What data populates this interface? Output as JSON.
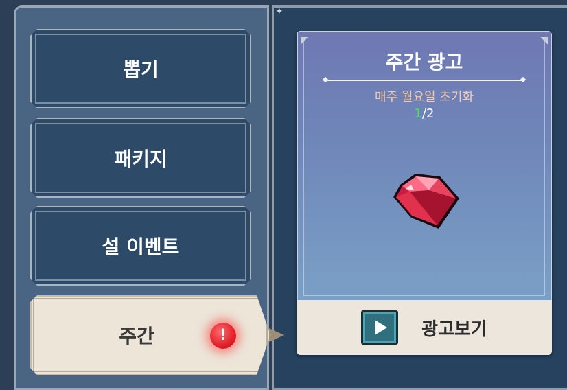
{
  "menu": {
    "items": [
      {
        "label": "뽑기"
      },
      {
        "label": "패키지"
      },
      {
        "label": "설 이벤트"
      },
      {
        "label": "주간",
        "active": true,
        "alert": "!"
      }
    ]
  },
  "ad_card": {
    "title": "주간 광고",
    "reset_text": "매주 월요일 초기화",
    "count_done": "1",
    "count_total": "/2",
    "reward_icon": "red-gem-icon",
    "watch_button_label": "광고보기",
    "watch_button_icon": "play-icon"
  },
  "colors": {
    "accent_done": "#4ee25a",
    "reset_text": "#f5c9a8",
    "alert": "#e0202a",
    "gem": "#d8254a"
  }
}
